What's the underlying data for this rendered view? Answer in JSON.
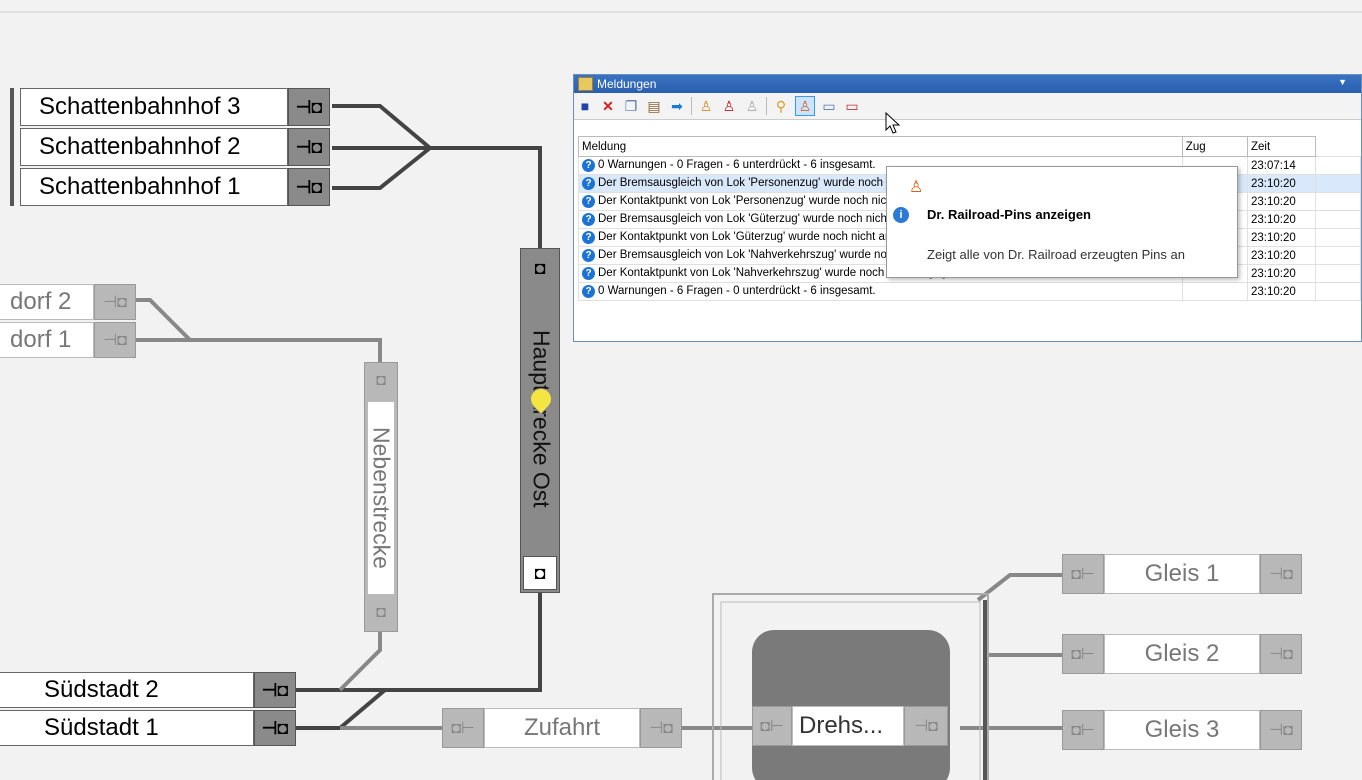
{
  "blocks": {
    "schattenbahnhof3": "Schattenbahnhof 3",
    "schattenbahnhof2": "Schattenbahnhof 2",
    "schattenbahnhof1": "Schattenbahnhof 1",
    "dorf2": "dorf 2",
    "dorf1": "dorf 1",
    "suedstadt2": "Südstadt 2",
    "suedstadt1": "Südstadt 1",
    "zufahrt": "Zufahrt",
    "drehscheibe": "Drehs...",
    "gleis1": "Gleis 1",
    "gleis2": "Gleis 2",
    "gleis3": "Gleis 3",
    "nebenstrecke": "Nebenstrecke",
    "hauptstrecke_ost": "Hauptstrecke Ost"
  },
  "window": {
    "title": "Meldungen",
    "columns": [
      "Meldung",
      "Zug",
      "Zeit"
    ],
    "rows": [
      {
        "meldung": "0 Warnungen - 0 Fragen - 6 unterdrückt - 6 insgesamt.",
        "zug": "",
        "zeit": "23:07:14"
      },
      {
        "meldung": "Der Bremsausgleich von Lok 'Personenzug' wurde noch nicht angegeben. Ist dies beabsich...",
        "zug": "",
        "zeit": "23:10:20"
      },
      {
        "meldung": "Der Kontaktpunkt von Lok 'Personenzug' wurde noch nicht angegeben. Ist dies beabsichtigt?",
        "zug": "",
        "zeit": "23:10:20"
      },
      {
        "meldung": "Der Bremsausgleich von Lok 'Güterzug' wurde noch nicht angegeben. Ist dies beabsichtigt?",
        "zug": "",
        "zeit": "23:10:20"
      },
      {
        "meldung": "Der Kontaktpunkt von Lok 'Güterzug' wurde noch nicht angegeben. Ist dies beabsichtigt?",
        "zug": "",
        "zeit": "23:10:20"
      },
      {
        "meldung": "Der Bremsausgleich von Lok 'Nahverkehrszug' wurde noch nicht angegeben. Ist dies beabsich...",
        "zug": "",
        "zeit": "23:10:20"
      },
      {
        "meldung": "Der Kontaktpunkt von Lok 'Nahverkehrszug' wurde noch nicht angegeben. Ist dies beabsich...",
        "zug": "",
        "zeit": "23:10:20"
      },
      {
        "meldung": "0 Warnungen - 6 Fragen - 0 unterdrückt - 6 insgesamt.",
        "zug": "",
        "zeit": "23:10:20"
      }
    ]
  },
  "tooltip": {
    "title": "Dr. Railroad-Pins anzeigen",
    "description": "Zeigt alle von Dr. Railroad erzeugten Pins an"
  },
  "colors": {
    "track": "#333333",
    "track_faded": "#888888",
    "title_bar": "#2a5fae",
    "selection": "#d9e8fa"
  }
}
